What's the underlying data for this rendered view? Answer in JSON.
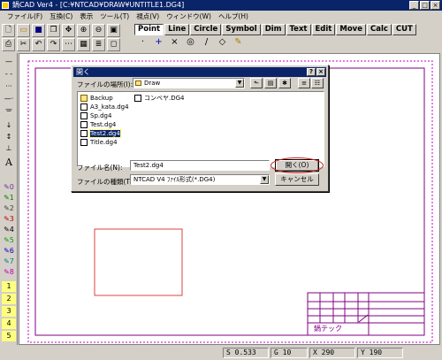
{
  "window": {
    "title": "鍋CAD Ver4 - [C:¥NTCAD¥DRAW¥UNTITLE1.DG4]",
    "controls": [
      "_",
      "□",
      "×"
    ]
  },
  "menu": [
    "ファイル(F)",
    "互換(C)",
    "表示",
    "ツール(T)",
    "視点(V)",
    "ウィンドウ(W)",
    "ヘルプ(H)"
  ],
  "toolbar": {
    "row1": [
      "new-icon",
      "open-icon",
      "save-icon",
      "copy-icon",
      "pan-icon",
      "zoom-in-icon",
      "zoom-out-icon",
      "zoom-fit-icon"
    ],
    "row2": [
      "print-icon",
      "cut-icon",
      "undo-icon",
      "redo-icon",
      "snap-icon",
      "grid-icon",
      "layer-icon",
      "frame-icon"
    ]
  },
  "tabs": [
    "Point",
    "Line",
    "Circle",
    "Symbol",
    "Dim",
    "Text",
    "Edit",
    "Move",
    "Calc",
    "CUT"
  ],
  "active_tab": "Point",
  "point_tools": [
    "·",
    "+",
    "×",
    "◎",
    "/",
    "◇",
    "✎"
  ],
  "left_tools": {
    "line_styles": [
      "—",
      "- -",
      "···",
      "—·—",
      "─"
    ],
    "symbols": [
      "↓",
      "↕",
      "⊥",
      "A"
    ],
    "pens": [
      "0",
      "1",
      "2",
      "3",
      "4",
      "5",
      "6",
      "7",
      "8"
    ],
    "layers": [
      "1",
      "2",
      "3",
      "4",
      "5"
    ]
  },
  "dialog": {
    "title": "開く",
    "help_btn": "?",
    "close_btn": "×",
    "location_label": "ファイルの場所(I):",
    "location_value": "Draw",
    "files": [
      {
        "name": "Backup",
        "type": "folder"
      },
      {
        "name": "コンベヤ.DG4",
        "type": "file"
      },
      {
        "name": "A3_kata.dg4",
        "type": "file"
      },
      {
        "name": "Sp.dg4",
        "type": "file"
      },
      {
        "name": "Test.dg4",
        "type": "file"
      },
      {
        "name": "Test2.dg4",
        "type": "file",
        "selected": true
      },
      {
        "name": "Title.dg4",
        "type": "file"
      }
    ],
    "filename_label": "ファイル名(N):",
    "filename_value": "Test2.dg4",
    "filetype_label": "ファイルの種類(T):",
    "filetype_value": "NTCAD V4 ﾌｧｲﾙ形式(*.DG4)",
    "open_button": "開く(O)",
    "cancel_button": "キャンセル"
  },
  "title_block": {
    "company": "鍋テック"
  },
  "status": {
    "scale": "S 0.533",
    "grid": "G 10",
    "x": "X 290",
    "y": "Y 190"
  }
}
